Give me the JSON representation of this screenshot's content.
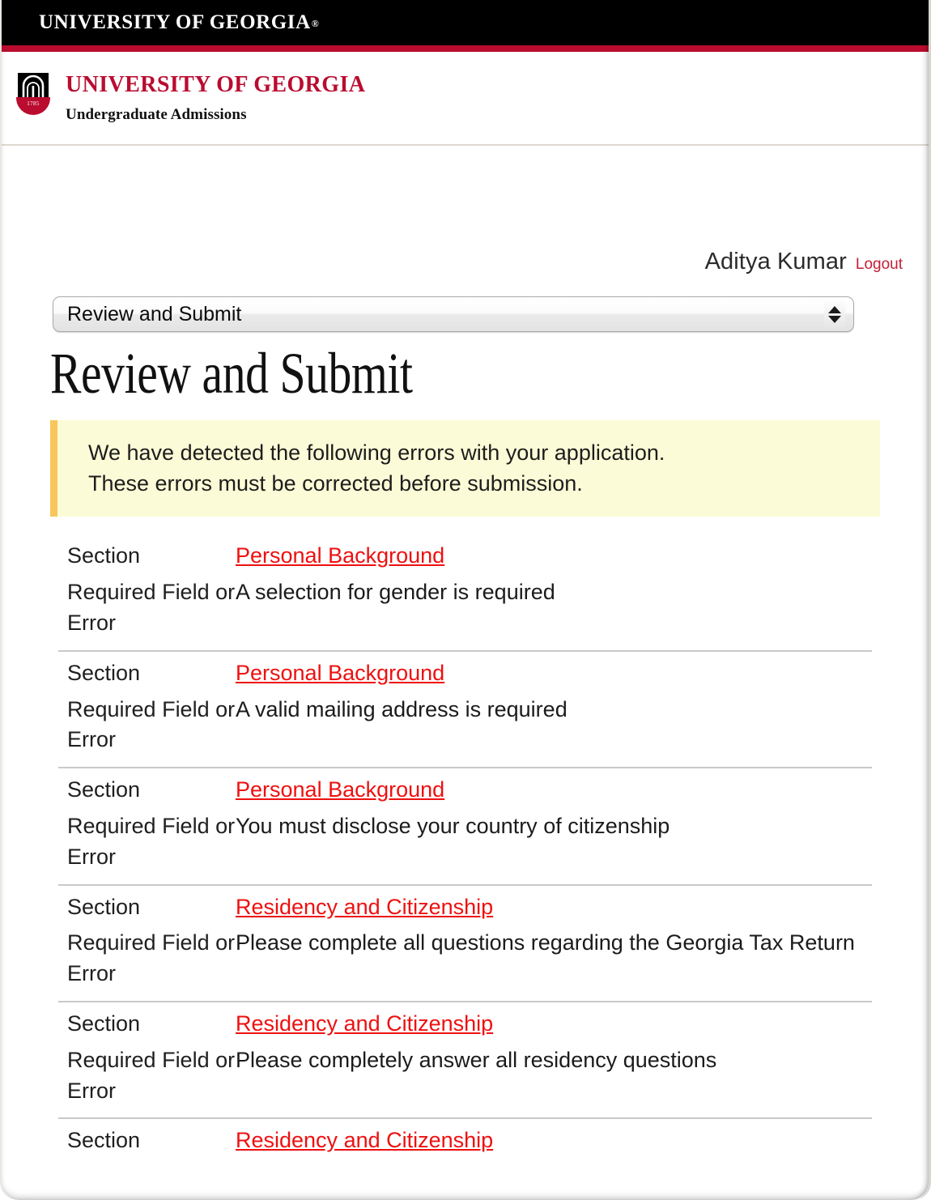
{
  "window": {
    "topbar_title": "UNIVERSITY OF GEORGIA",
    "topbar_tm": "®"
  },
  "brand": {
    "logo_icon": "uga-arch-icon",
    "logo_year": "1785",
    "title": "UNIVERSITY OF GEORGIA",
    "subtitle": "Undergraduate Admissions"
  },
  "account": {
    "user_name": "Aditya Kumar",
    "logout_label": "Logout"
  },
  "section_nav": {
    "selected": "Review and Submit",
    "stepper_up_icon": "triangle-up-icon",
    "stepper_down_icon": "triangle-down-icon",
    "options": [
      "Review and Submit"
    ]
  },
  "page": {
    "title": "Review and Submit"
  },
  "alert": {
    "line1": "We have detected the following errors with your application.",
    "line2": "These errors must be corrected before submission."
  },
  "labels": {
    "section": "Section",
    "required_field_or_error": "Required Field or Error"
  },
  "errors": [
    {
      "section": "Personal Background",
      "message": "A selection for gender is required"
    },
    {
      "section": "Personal Background",
      "message": "A valid mailing address is required"
    },
    {
      "section": "Personal Background",
      "message": "You must disclose your country of citizenship"
    },
    {
      "section": "Residency and Citizenship",
      "message": "Please complete all questions regarding the Georgia Tax Return"
    },
    {
      "section": "Residency and Citizenship",
      "message": "Please completely answer all residency questions"
    },
    {
      "section": "Residency and Citizenship",
      "message": ""
    }
  ],
  "colors": {
    "uga_crimson": "#ba0c2f",
    "link_red": "#ee1010",
    "logout_red": "#c32035",
    "alert_bg": "#fcfbd7",
    "alert_accent": "#f8c65a",
    "topbar_black": "#000000"
  }
}
